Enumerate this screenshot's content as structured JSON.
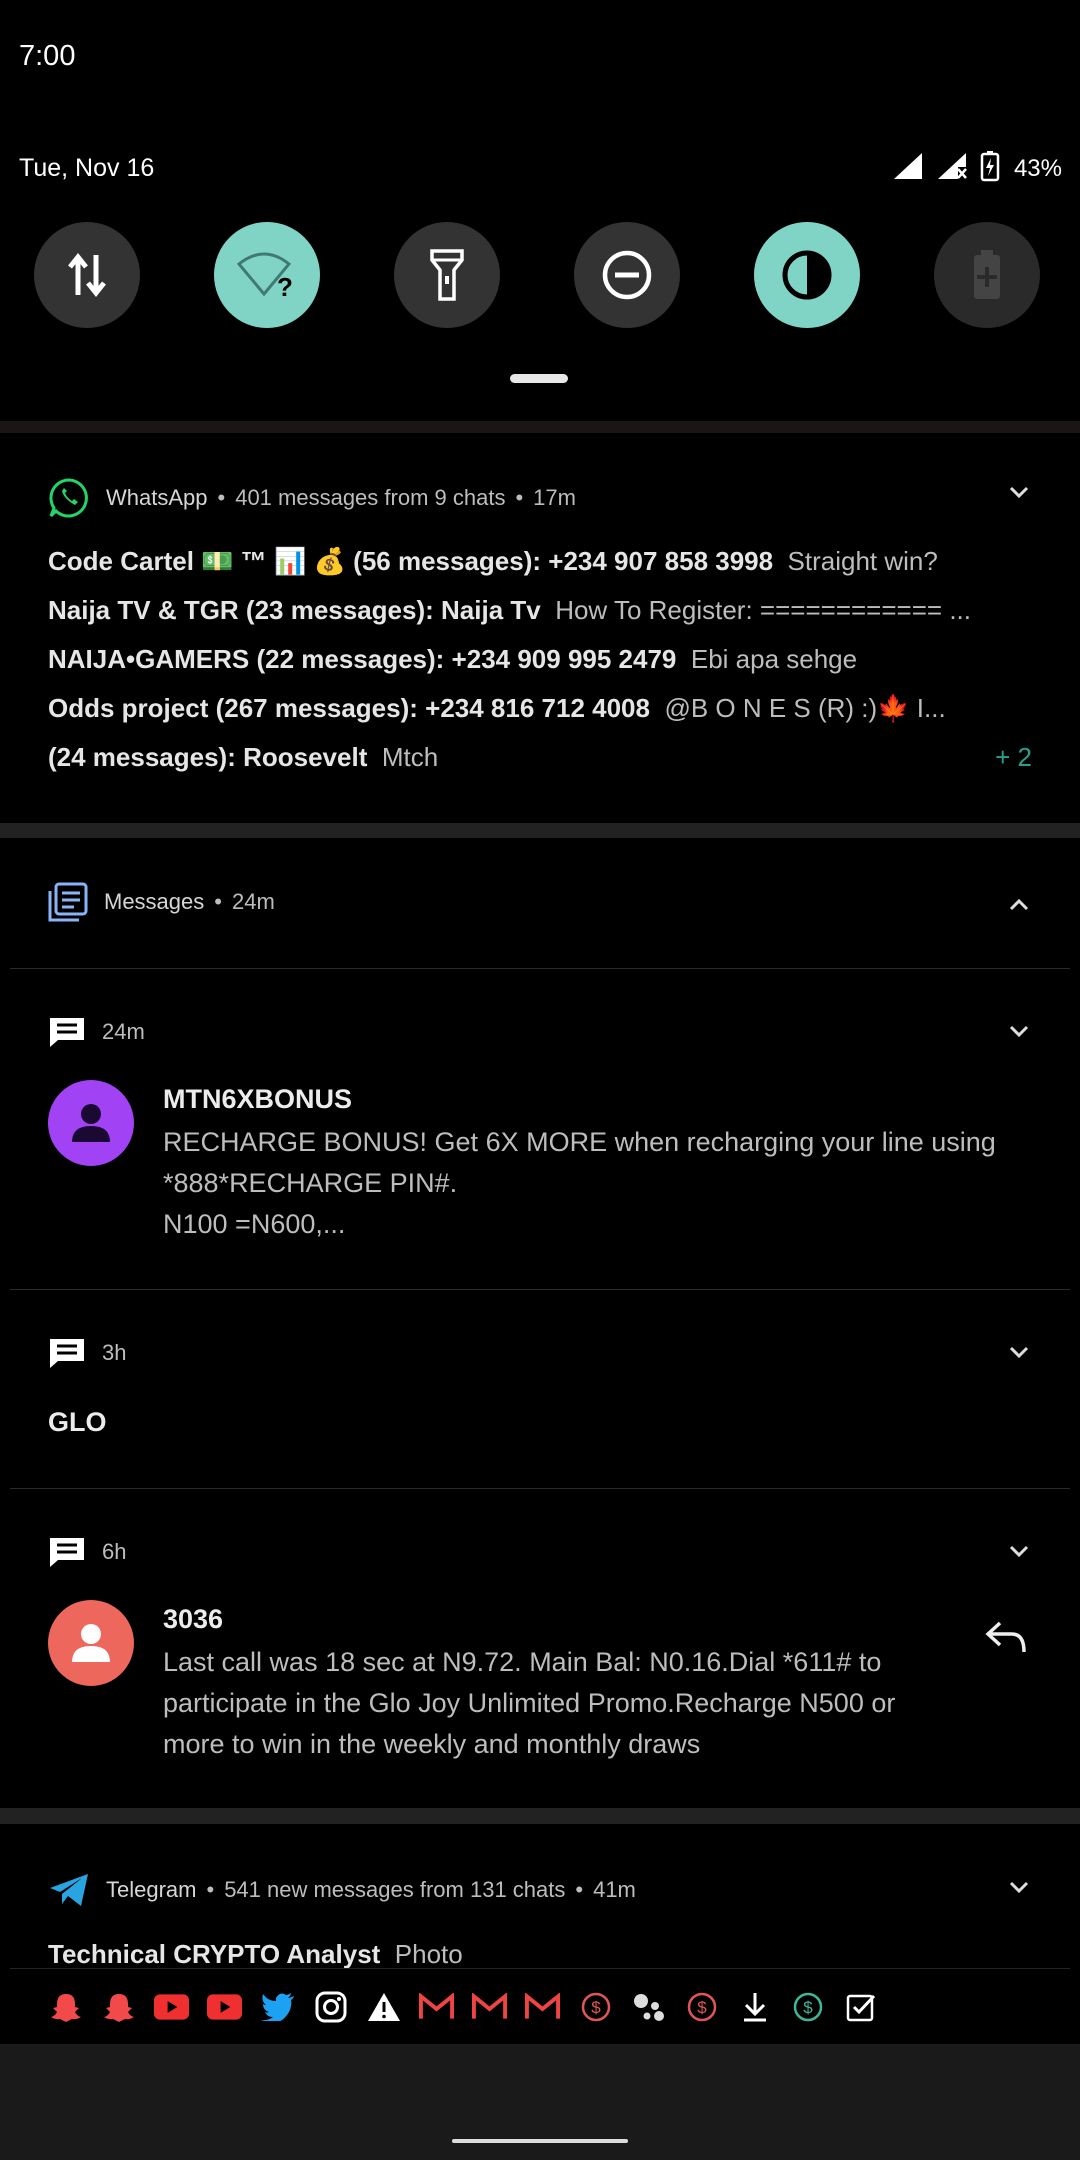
{
  "status_bar": {
    "time": "7:00",
    "date": "Tue, Nov 16",
    "battery": "43%"
  },
  "quick_settings": [
    {
      "name": "mobile-data",
      "on": false
    },
    {
      "name": "wifi",
      "on": true
    },
    {
      "name": "flashlight",
      "on": false
    },
    {
      "name": "do-not-disturb",
      "on": false
    },
    {
      "name": "dark-theme",
      "on": true
    },
    {
      "name": "battery-saver",
      "on": false
    }
  ],
  "whatsapp": {
    "app": "WhatsApp",
    "summary": "401 messages from 9 chats",
    "time": "17m",
    "lines": [
      {
        "title": "Code Cartel 💵 ™ 📊 💰 (56 messages): +234 907 858 3998",
        "text": "Straight win?"
      },
      {
        "title": "Naija TV & TGR  (23 messages): Naija Tv",
        "text": "How To Register: ============ ..."
      },
      {
        "title": "NAIJA•GAMERS (22 messages): +234 909 995 2479",
        "text": "Ebi apa sehge"
      },
      {
        "title": "Odds project (267 messages): +234 816 712 4008",
        "text": "@B O N E S (R)      :)🍁 I..."
      },
      {
        "title": " (24 messages): Roosevelt",
        "text": "Mtch"
      }
    ],
    "more": "+ 2"
  },
  "messages": {
    "app": "Messages",
    "time": "24m",
    "items": [
      {
        "time": "24m",
        "sender": "MTN6XBONUS",
        "body": [
          "RECHARGE BONUS! Get 6X MORE when recharging your line using",
          "*888*RECHARGE PIN#.",
          "N100 =N600,..."
        ]
      },
      {
        "time": "3h",
        "sender": "GLO"
      },
      {
        "time": "6h",
        "sender": "3036",
        "body": [
          "Last call was 18 sec at N9.72. Main Bal: N0.16.Dial *611# to",
          "participate in the Glo Joy Unlimited Promo.Recharge N500 or",
          "more to win in the weekly and  monthly draws"
        ]
      }
    ]
  },
  "telegram": {
    "app": "Telegram",
    "summary": "541 new messages from 131 chats",
    "time": "41m",
    "line": {
      "title": "Technical CRYPTO Analyst",
      "text": "Photo"
    }
  },
  "tray_icons": [
    "snapchat-icon",
    "snapchat-icon",
    "youtube-icon",
    "youtube-icon",
    "twitter-icon",
    "instagram-icon",
    "warning-icon",
    "gmail-icon",
    "gmail-icon",
    "gmail-icon",
    "dollar-icon",
    "assistant-icon",
    "dollar-icon",
    "download-icon",
    "dollar-icon",
    "checkbox-icon"
  ],
  "colors": {
    "accent_teal": "#7fd4c6",
    "whatsapp": "#25d366",
    "messages": "#8ab4f8",
    "avatar_purple": "#a142f4",
    "avatar_red": "#ee675c",
    "telegram": "#2aa3e1"
  }
}
